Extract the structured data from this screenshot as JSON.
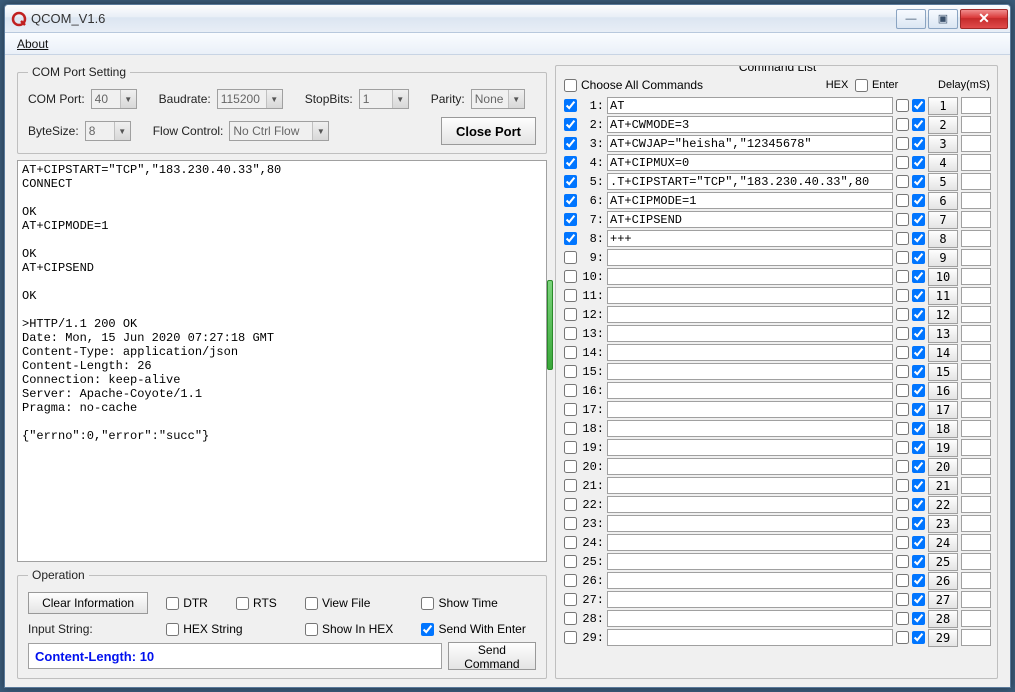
{
  "window": {
    "title": "QCOM_V1.6"
  },
  "menu": {
    "about": "About"
  },
  "winbtns": {
    "min": "—",
    "max": "▣",
    "close": "✕"
  },
  "com": {
    "legend": "COM Port Setting",
    "port_lbl": "COM Port:",
    "port_val": "40",
    "baud_lbl": "Baudrate:",
    "baud_val": "115200",
    "stop_lbl": "StopBits:",
    "stop_val": "1",
    "parity_lbl": "Parity:",
    "parity_val": "None",
    "byte_lbl": "ByteSize:",
    "byte_val": "8",
    "flow_lbl": "Flow Control:",
    "flow_val": "No Ctrl Flow",
    "close_btn": "Close Port"
  },
  "terminal_text": "AT+CIPSTART=\"TCP\",\"183.230.40.33\",80\nCONNECT\n\nOK\nAT+CIPMODE=1\n\nOK\nAT+CIPSEND\n\nOK\n\n>HTTP/1.1 200 OK\nDate: Mon, 15 Jun 2020 07:27:18 GMT\nContent-Type: application/json\nContent-Length: 26\nConnection: keep-alive\nServer: Apache-Coyote/1.1\nPragma: no-cache\n\n{\"errno\":0,\"error\":\"succ\"}",
  "op": {
    "legend": "Operation",
    "clear": "Clear Information",
    "dtr": "DTR",
    "rts": "RTS",
    "view": "View File",
    "showtime": "Show Time",
    "input_lbl": "Input String:",
    "hexstr": "HEX String",
    "showhex": "Show In HEX",
    "sendenter": "Send With Enter",
    "input_val": "Content-Length: 10",
    "send": "Send Command"
  },
  "cmd": {
    "legend": "Command List",
    "choose_all": "Choose All Commands",
    "hex_hdr": "HEX",
    "enter_hdr": "Enter",
    "delay_hdr": "Delay(mS)",
    "rows": [
      {
        "chk": true,
        "text": "AT"
      },
      {
        "chk": true,
        "text": "AT+CWMODE=3"
      },
      {
        "chk": true,
        "text": "AT+CWJAP=\"heisha\",\"12345678\""
      },
      {
        "chk": true,
        "text": "AT+CIPMUX=0"
      },
      {
        "chk": true,
        "text": ".T+CIPSTART=\"TCP\",\"183.230.40.33\",80"
      },
      {
        "chk": true,
        "text": "AT+CIPMODE=1"
      },
      {
        "chk": true,
        "text": "AT+CIPSEND"
      },
      {
        "chk": true,
        "text": "+++"
      },
      {
        "chk": false,
        "text": ""
      },
      {
        "chk": false,
        "text": ""
      },
      {
        "chk": false,
        "text": ""
      },
      {
        "chk": false,
        "text": ""
      },
      {
        "chk": false,
        "text": ""
      },
      {
        "chk": false,
        "text": ""
      },
      {
        "chk": false,
        "text": ""
      },
      {
        "chk": false,
        "text": ""
      },
      {
        "chk": false,
        "text": ""
      },
      {
        "chk": false,
        "text": ""
      },
      {
        "chk": false,
        "text": ""
      },
      {
        "chk": false,
        "text": ""
      },
      {
        "chk": false,
        "text": ""
      },
      {
        "chk": false,
        "text": ""
      },
      {
        "chk": false,
        "text": ""
      },
      {
        "chk": false,
        "text": ""
      },
      {
        "chk": false,
        "text": ""
      },
      {
        "chk": false,
        "text": ""
      },
      {
        "chk": false,
        "text": ""
      },
      {
        "chk": false,
        "text": ""
      },
      {
        "chk": false,
        "text": ""
      }
    ]
  }
}
